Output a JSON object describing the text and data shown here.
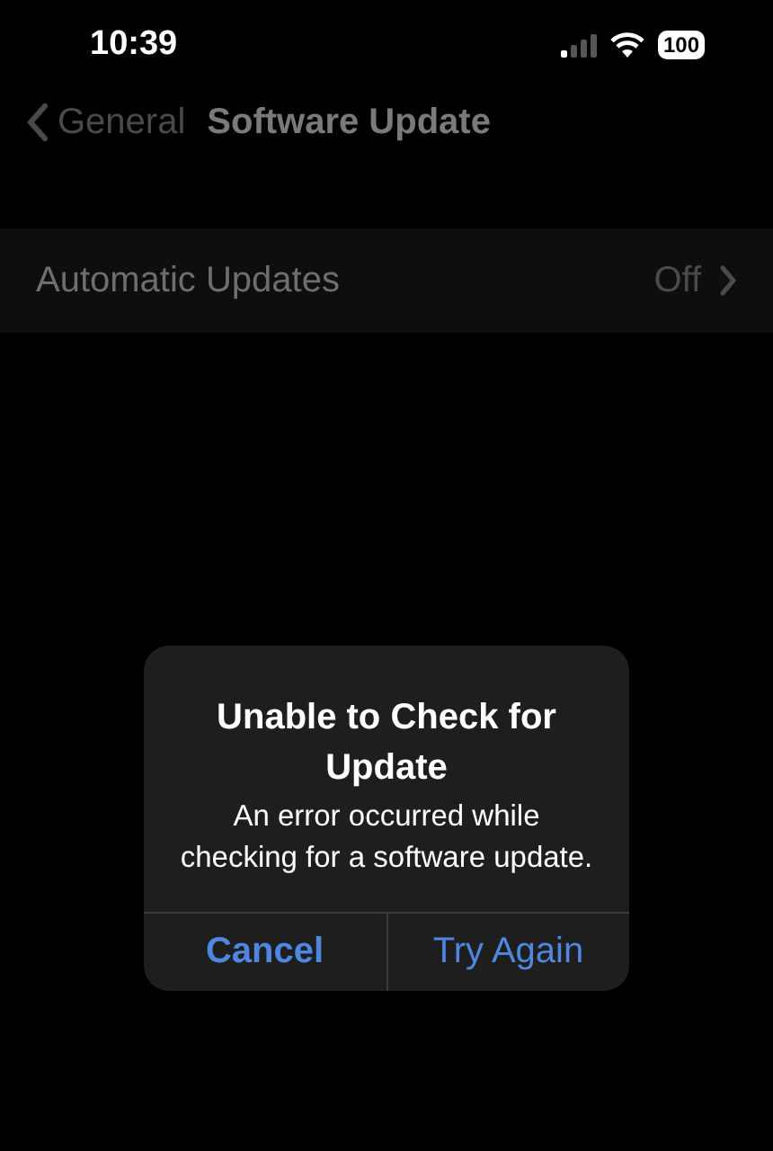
{
  "status_bar": {
    "time": "10:39",
    "battery": "100"
  },
  "nav": {
    "back": "General",
    "title": "Software Update"
  },
  "rows": [
    {
      "label": "Automatic Updates",
      "value": "Off"
    }
  ],
  "alert": {
    "title": "Unable to Check for Update",
    "message": "An error occurred while checking for a software update.",
    "buttons": [
      {
        "label": "Cancel",
        "bold": true
      },
      {
        "label": "Try Again",
        "bold": false
      }
    ]
  }
}
